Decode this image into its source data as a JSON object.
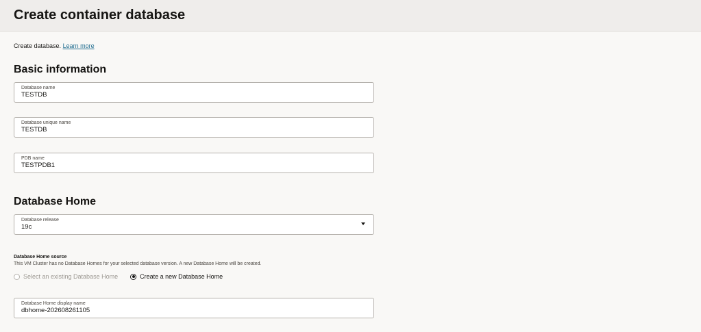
{
  "header": {
    "title": "Create container database"
  },
  "intro": {
    "text": "Create database.",
    "link": "Learn more"
  },
  "basic": {
    "title": "Basic information",
    "db_name": {
      "label": "Database name",
      "value": "TESTDB"
    },
    "db_unique_name": {
      "label": "Database unique name",
      "value": "TESTDB"
    },
    "pdb_name": {
      "label": "PDB name",
      "value": "TESTPDB1"
    }
  },
  "home": {
    "title": "Database Home",
    "release": {
      "label": "Database release",
      "value": "19c"
    },
    "source": {
      "label": "Database Home source",
      "help": "This VM Cluster has no Database Homes for your selected database version. A new Database Home will be created.",
      "options": [
        {
          "label": "Select an existing Database Home",
          "selected": false,
          "disabled": true
        },
        {
          "label": "Create a new Database Home",
          "selected": true,
          "disabled": false
        }
      ]
    },
    "display_name": {
      "label": "Database Home display name",
      "value": "dbhome-202608261105"
    }
  }
}
